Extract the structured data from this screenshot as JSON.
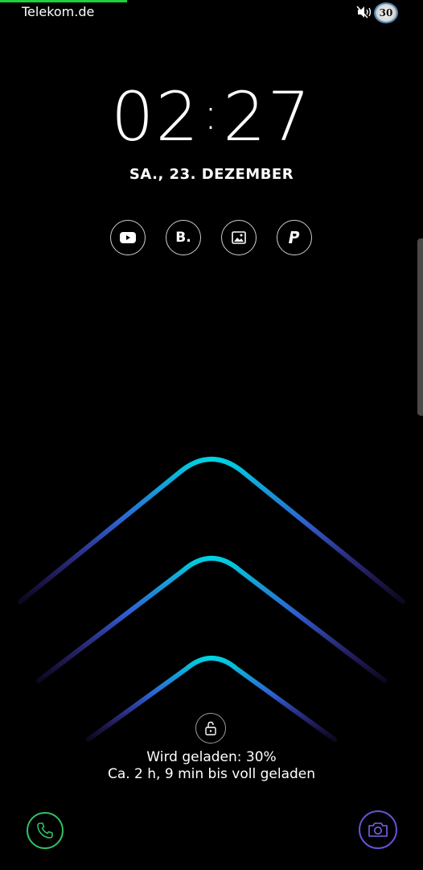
{
  "status_bar": {
    "carrier": "Telekom.de",
    "battery_level": "30",
    "charge_fraction": 0.3,
    "icons": [
      "vibrate-mute-icon",
      "battery-circle-icon"
    ],
    "charge_color": "#1fd13a"
  },
  "clock": {
    "hours": "02",
    "separator": ":",
    "minutes": "27"
  },
  "date": "SA., 23. DEZEMBER",
  "shortcuts": [
    {
      "name": "youtube",
      "icon": "youtube-icon"
    },
    {
      "name": "booking",
      "label": "B.",
      "icon": "booking-icon"
    },
    {
      "name": "gallery",
      "icon": "gallery-icon"
    },
    {
      "name": "paypal",
      "icon": "paypal-icon"
    }
  ],
  "lock": {
    "icon": "unlock-icon"
  },
  "charging": {
    "line1": "Wird geladen: 30%",
    "line2": "Ca. 2 h, 9 min bis voll geladen"
  },
  "bottom": {
    "left_icon": "phone-icon",
    "right_icon": "camera-icon",
    "phone_color": "#2fbf62",
    "camera_color": "#6b4fd8"
  },
  "wallpaper": {
    "colors": [
      "#00d0e0",
      "#2f5fd0",
      "#5a2fc0"
    ]
  }
}
